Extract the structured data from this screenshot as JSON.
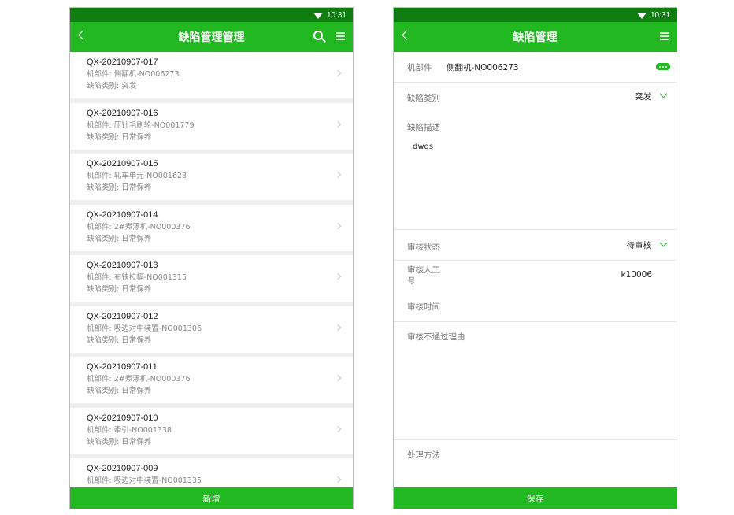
{
  "status_bar": {
    "time": "10:31"
  },
  "list_screen": {
    "title": "缺陷管理管理",
    "items": [
      {
        "code": "QX-20210907-017",
        "part": "机部件: 侧翻机-NO006273",
        "category": "缺陷类别: 突发"
      },
      {
        "code": "QX-20210907-016",
        "part": "机部件: 压针毛刷轮-NO001779",
        "category": "缺陷类别: 日常保养"
      },
      {
        "code": "QX-20210907-015",
        "part": "机部件: 轧车单元-NO001623",
        "category": "缺陷类别: 日常保养"
      },
      {
        "code": "QX-20210907-014",
        "part": "机部件: 2#煮漂机-NO000376",
        "category": "缺陷类别: 日常保养"
      },
      {
        "code": "QX-20210907-013",
        "part": "机部件: 布铗拉幅-NO001315",
        "category": "缺陷类别: 日常保养"
      },
      {
        "code": "QX-20210907-012",
        "part": "机部件: 吸边对中装置-NO001306",
        "category": "缺陷类别: 日常保养"
      },
      {
        "code": "QX-20210907-011",
        "part": "机部件: 2#煮漂机-NO000376",
        "category": "缺陷类别: 日常保养"
      },
      {
        "code": "QX-20210907-010",
        "part": "机部件: 牵引-NO001338",
        "category": "缺陷类别: 日常保养"
      },
      {
        "code": "QX-20210907-009",
        "part": "机部件: 吸边对中装置-NO001335",
        "category": ""
      }
    ],
    "add_button": "新增"
  },
  "detail_screen": {
    "title": "缺陷管理",
    "part_label": "机部件",
    "part_value": "侧翻机-NO006273",
    "category_label": "缺陷类别",
    "category_value": "突发",
    "description_label": "缺陷描述",
    "description_value": "dwds",
    "review_status_label": "审核状态",
    "review_status_value": "待审核",
    "reviewer_label_line1": "审核人工",
    "reviewer_label_line2": "号",
    "reviewer_value": "k10006",
    "review_time_label": "审核时间",
    "reject_reason_label": "审核不通过理由",
    "handling_label": "处理方法",
    "save_button": "保存"
  },
  "colors": {
    "primary": "#22b822",
    "status_bar": "#0f7d0f"
  }
}
